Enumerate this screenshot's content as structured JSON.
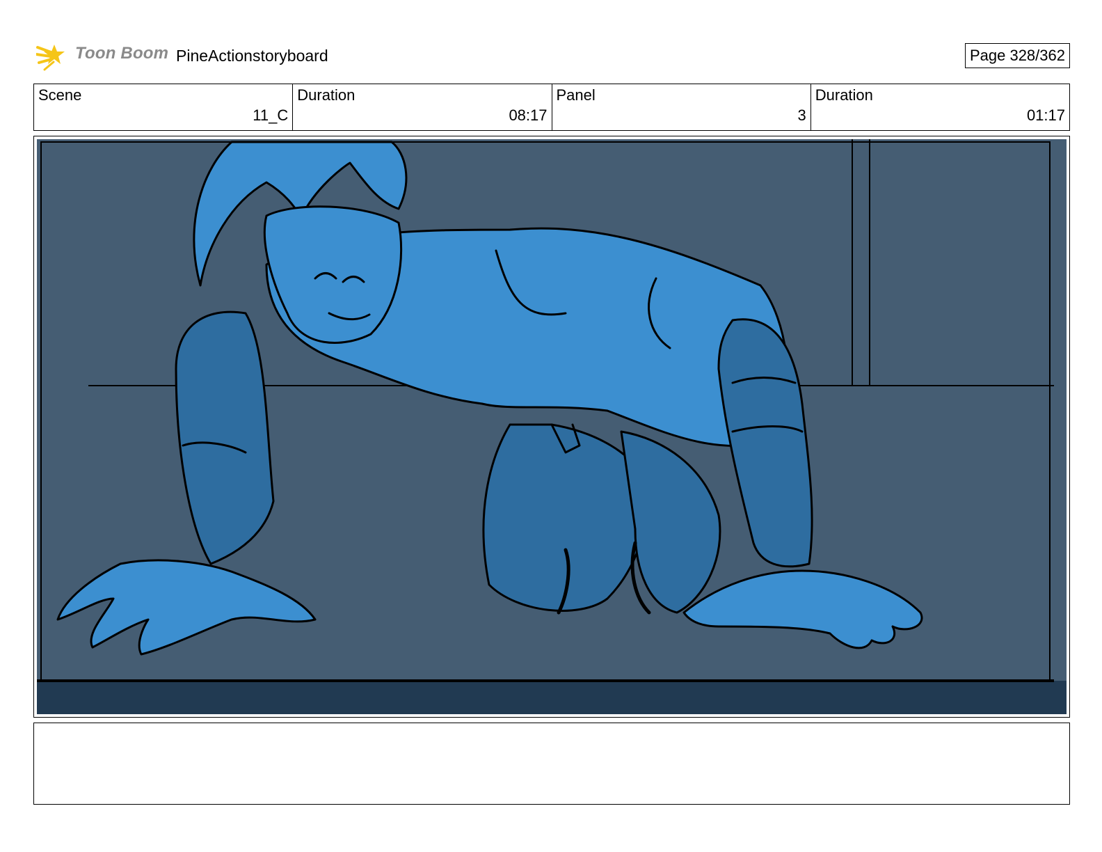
{
  "header": {
    "logo_text": "Toon Boom",
    "project_title": "PineActionstoryboard",
    "page_label": "Page 328/362"
  },
  "info": {
    "scene_label": "Scene",
    "scene_value": "11_C",
    "scene_duration_label": "Duration",
    "scene_duration_value": "08:17",
    "panel_label": "Panel",
    "panel_value": "3",
    "panel_duration_label": "Duration",
    "panel_duration_value": "01:17"
  },
  "notes": {
    "text": ""
  },
  "colors": {
    "logo_star": "#f5c518",
    "background_wall": "#455d73",
    "floor_strip": "#213a52",
    "character_fill": "#3c8fd0",
    "character_shade": "#2e6da0",
    "line": "#000000"
  },
  "icons": {
    "logo": "shooting-star-icon"
  }
}
